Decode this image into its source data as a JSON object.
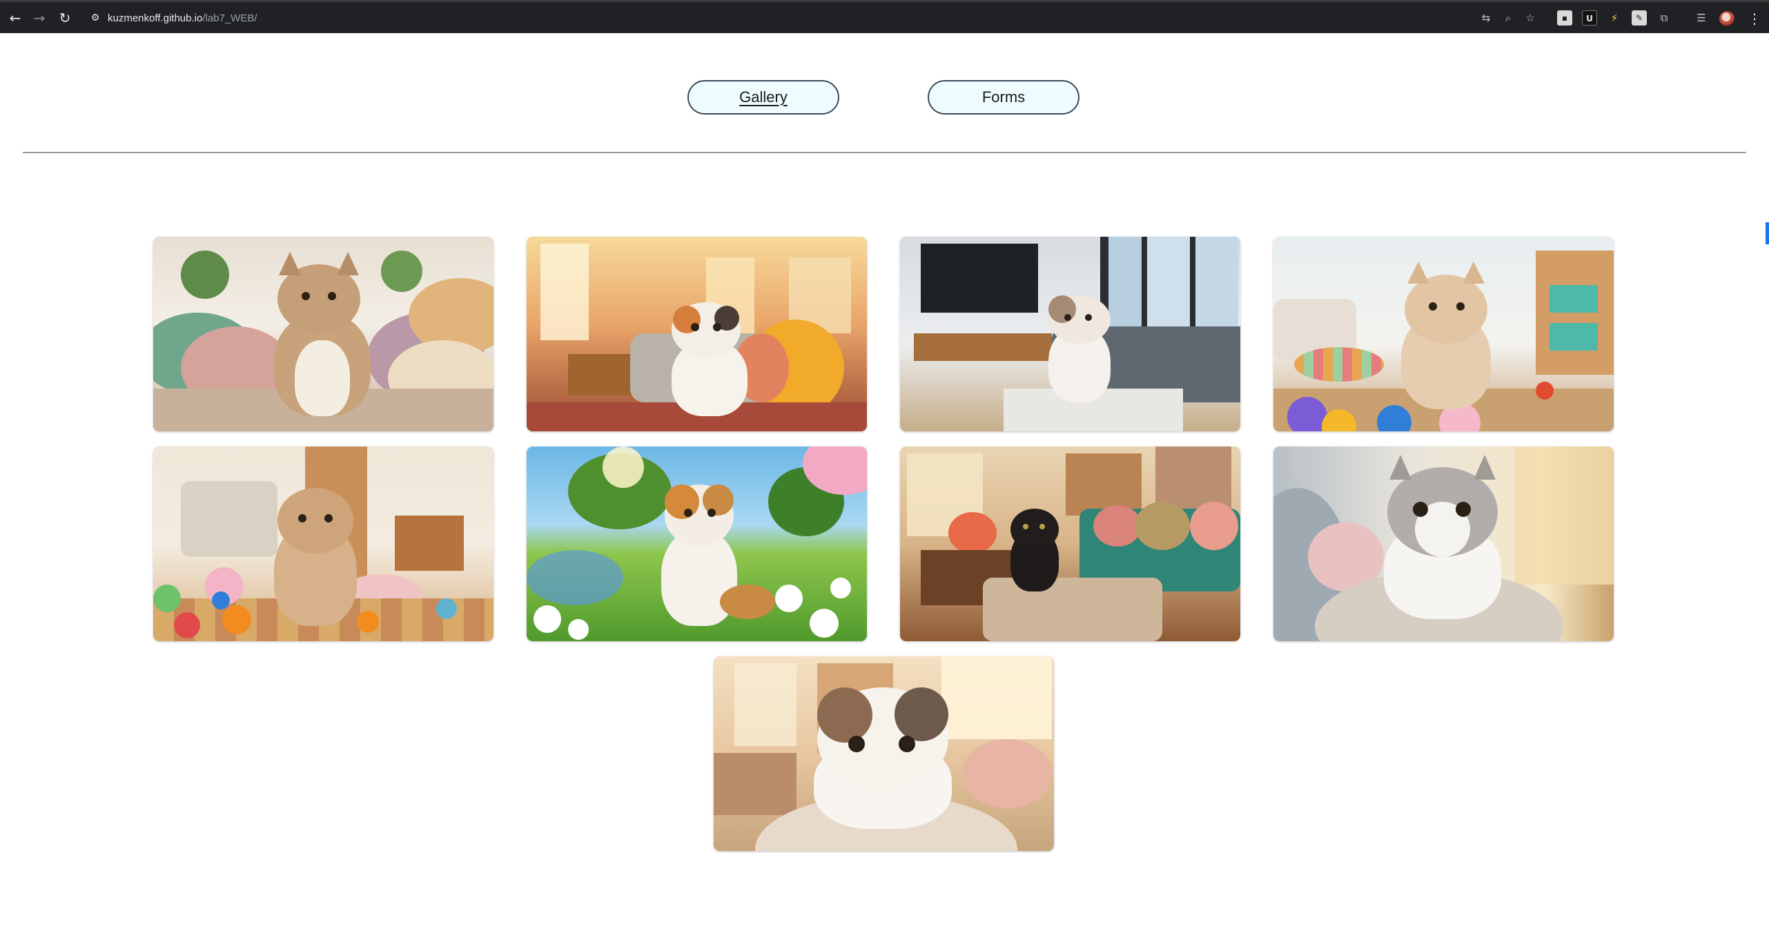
{
  "browser": {
    "url_host": "kuzmenkoff.github.io",
    "url_path": "/lab7_WEB/",
    "icons": [
      "back-icon",
      "forward-icon",
      "reload-icon",
      "site-info-icon",
      "translate-icon",
      "zoom-icon",
      "bookmark-star-icon",
      "extension-icon",
      "extension-icon",
      "extension-icon",
      "extension-icon",
      "extensions-puzzle-icon",
      "tab-search-icon",
      "profile-avatar",
      "more-menu-icon"
    ]
  },
  "nav": {
    "gallery_label": "Gallery",
    "forms_label": "Forms",
    "active": "Gallery"
  },
  "gallery": {
    "images": [
      {
        "subject": "fluffy tabby kitten on cushions"
      },
      {
        "subject": "calico kitten on sofa in sunny living room"
      },
      {
        "subject": "kitten on grey sofa by window"
      },
      {
        "subject": "cream kitten on rug with toys"
      },
      {
        "subject": "tabby kitten among colorful toy balls"
      },
      {
        "subject": "calico kitten in daisy meadow"
      },
      {
        "subject": "black kitten on ottoman"
      },
      {
        "subject": "grey and white kitten on pillow"
      },
      {
        "subject": "fluffy calico kitten on cushion"
      }
    ]
  },
  "colors": {
    "nav_button_bg": "#eefcff",
    "nav_button_border": "#3c4a5a",
    "divider": "#9a9a9a",
    "chrome_bg": "#202124"
  }
}
